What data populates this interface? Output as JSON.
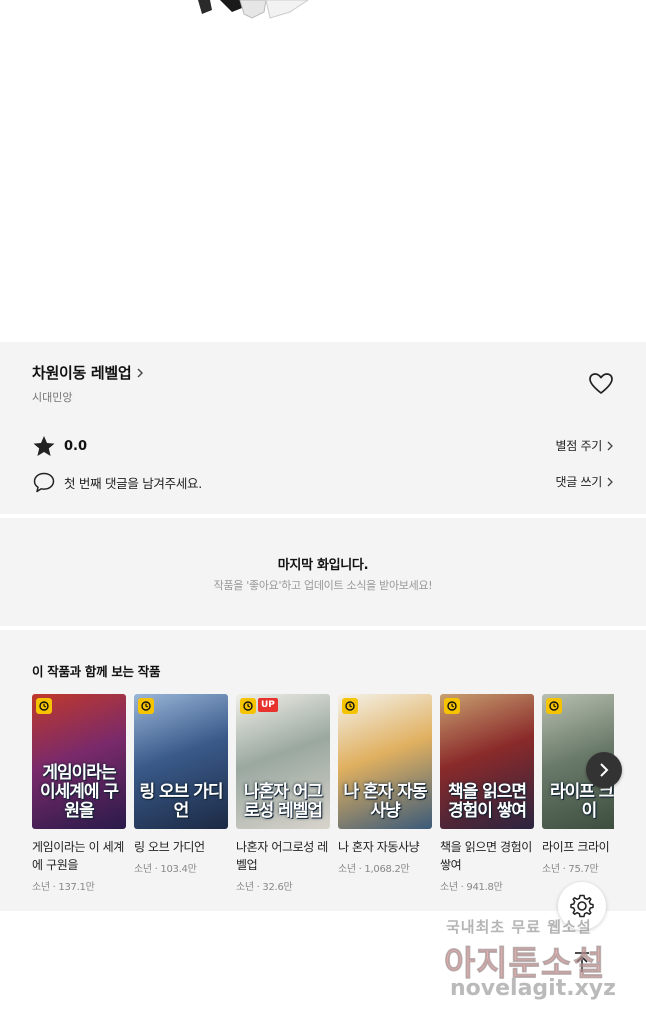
{
  "series": {
    "title": "차원이동 레벨업",
    "author": "시대민앙",
    "rating": "0.0",
    "rate_action": "별점 주기",
    "comment_prompt": "첫 번째 댓글을 남겨주세요.",
    "comment_action": "댓글 쓰기"
  },
  "last_chapter": {
    "title": "마지막 화입니다.",
    "subtitle": "작품을 '좋아요'하고 업데이트 소식을 받아보세요!"
  },
  "recommendations": {
    "heading": "이 작품과 함께 보는 작품",
    "items": [
      {
        "name": "게임이라는 이 세계에 구원을",
        "meta": "소년 · 137.1만",
        "cover_text": "게임이라는 이세계에 구원을",
        "badge_up": "",
        "colors": [
          "#2a1a4a",
          "#7a2a6a",
          "#c0392b"
        ]
      },
      {
        "name": "링 오브 가디언",
        "meta": "소년 · 103.4만",
        "cover_text": "링 오브 가디언",
        "badge_up": "",
        "colors": [
          "#1c2a44",
          "#3a5a8a",
          "#9ab6d8"
        ]
      },
      {
        "name": "나혼자 어그로성 레벨업",
        "meta": "소년 · 32.6만",
        "cover_text": "나혼자 어그로성 레벨업",
        "badge_up": "UP",
        "colors": [
          "#d8d4cc",
          "#9aa8a0",
          "#f0efe8"
        ]
      },
      {
        "name": "나 혼자 자동사냥",
        "meta": "소년 · 1,068.2만",
        "cover_text": "나 혼자 자동사냥",
        "badge_up": "",
        "colors": [
          "#3a5a7a",
          "#e0b060",
          "#f4f2ea"
        ]
      },
      {
        "name": "책을 읽으면 경험이 쌓여",
        "meta": "소년 · 941.8만",
        "cover_text": "책을 읽으면 경험이 쌓여",
        "badge_up": "",
        "colors": [
          "#2a2440",
          "#8a2a2a",
          "#c8a070"
        ]
      },
      {
        "name": "라이프 크라이",
        "meta": "소년 · 75.7만",
        "cover_text": "라이프 크라이",
        "badge_up": "",
        "colors": [
          "#3a4a3a",
          "#6a7a6a",
          "#b8c0b0"
        ]
      }
    ]
  },
  "watermark": {
    "line1": "국내최초 무료 웹소설",
    "line2": "아지툰소설",
    "line3": "novelagit.xyz"
  },
  "icons": {
    "title_chevron": "chevron-right-icon",
    "like": "heart-outline-icon",
    "rating": "star-filled-icon",
    "comment": "speech-bubble-icon",
    "next": "chevron-right-icon",
    "settings": "gear-icon",
    "scroll_top": "arrow-up-icon",
    "badge": "clock-icon"
  }
}
